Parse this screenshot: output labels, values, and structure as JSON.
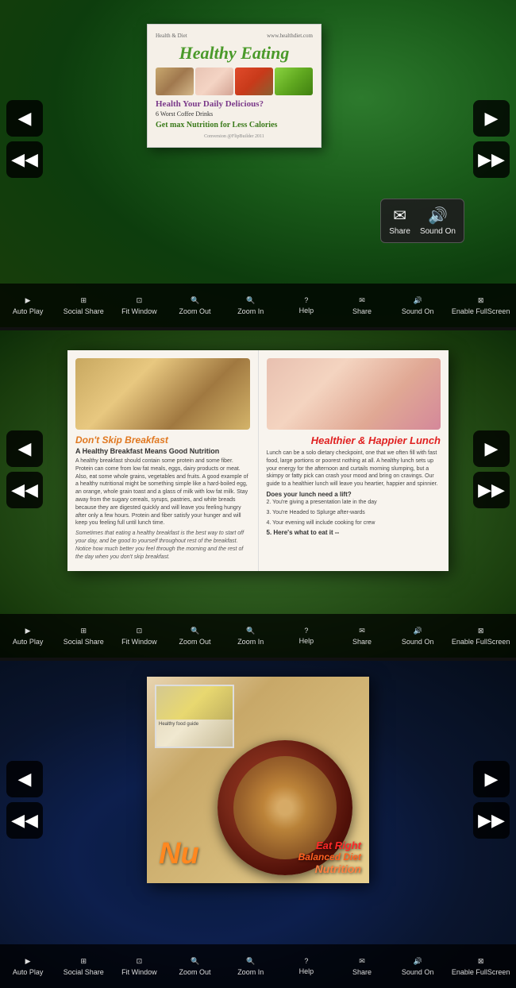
{
  "sections": [
    {
      "id": "section-1",
      "background": "green-nature",
      "book": {
        "type": "single",
        "header_left": "Health & Diet",
        "header_right": "www.healthdiet.com",
        "title": "Healthy Eating",
        "subtitle": "Health Your Daily Delicious?",
        "item1": "6 Worst Coffee Drinks",
        "item2": "Get max Nutrition for Less Calories",
        "footer": "Conversion @FlipBuilder 2011"
      },
      "popup": {
        "visible": true,
        "label": "Share Sound",
        "icons": [
          {
            "label": "Share",
            "symbol": "✉"
          },
          {
            "label": "Sound On",
            "symbol": "🔊"
          }
        ]
      }
    },
    {
      "id": "section-2",
      "background": "green-dark",
      "book": {
        "type": "double",
        "left_page": {
          "title": "Don't Skip Breakfast",
          "subtitle": "A Healthy Breakfast Means Good Nutrition",
          "body": "A healthy breakfast should contain some protein and some fiber. Protein can come from low fat meals, eggs, dairy products or meat. Also, eat some whole grains, vegetables and fruits. A good example of a healthy nutritional might be something simple like a hard-boiled egg, an orange, whole grain toast and a glass of milk with low fat milk. Stay away from the sugary cereals, syrups, pastries, and white breads because they are digested quickly and will leave you feeling hungry after only a few hours. Protein and fiber satisfy your hunger and will keep you feeling full until lunch time.",
          "sidebar_text": "Sometimes that eating a healthy breakfast is the best way to start off your day, and be good to yourself throughout rest of the breakfast. Notice how much better you feel through the morning and the rest of the day when you don't skip breakfast."
        },
        "right_page": {
          "title": "Healthier & Happier Lunch",
          "sections": [
            "Does your lunch need a lift?",
            "2. You're giving a presentation late in the day",
            "3. You're Headed to Splurge after-wards",
            "4. Your evening will include cooking for crew",
            "5. Here's what to eat it --"
          ],
          "body": "Lunch can be a solo dietary checkpoint, one that we often fill with fast food, large portions or poorest nothing at all. A healthy lunch sets up your energy for the afternoon and curtails morning slumping, but a skimpy or fatty pick can crash your mood and bring on cravings. Our guide to a healthier lunch will leave you heartier, happier and spinnier."
        }
      }
    },
    {
      "id": "section-3",
      "background": "dark-blue",
      "book": {
        "type": "single-food",
        "text_nu": "Nu",
        "text_eat": "Eat Right",
        "text_balanced": "Balanced Diet",
        "text_nutrition": "Nutrition"
      }
    }
  ],
  "toolbar": {
    "items": [
      {
        "label": "Auto Play",
        "icon": "▶"
      },
      {
        "label": "Social Share",
        "icon": "⊞"
      },
      {
        "label": "Fit Window",
        "icon": "⊡"
      },
      {
        "label": "Zoom Out",
        "icon": "🔍"
      },
      {
        "label": "Zoom In",
        "icon": "🔍"
      },
      {
        "label": "Help",
        "icon": "?"
      },
      {
        "label": "Share",
        "icon": "✉"
      },
      {
        "label": "Sound On",
        "icon": "🔊"
      },
      {
        "label": "Enable FullScreen",
        "icon": "⊠"
      }
    ]
  },
  "nav": {
    "prev_label": "◀",
    "next_label": "▶",
    "first_label": "◀◀",
    "last_label": "▶▶"
  }
}
